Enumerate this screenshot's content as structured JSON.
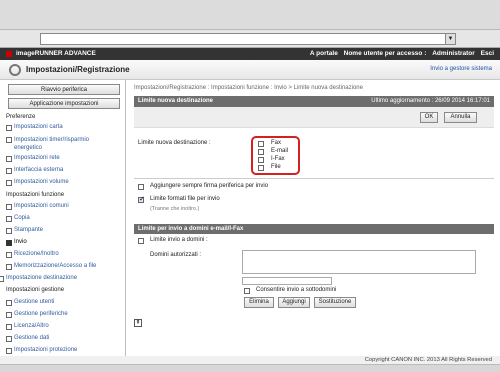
{
  "header": {
    "app_name": "imageRUNNER ADVANCE",
    "portal": "A portale",
    "user_label": "Nome utente per accesso :",
    "user_name": "Administrator",
    "logout": "Esci"
  },
  "page": {
    "title": "Impostazioni/Registrazione",
    "admin_link": "Invio a gestore sistema"
  },
  "sidebar": {
    "buttons": [
      "Riavvio periferica",
      "Applicazione impostazioni"
    ],
    "sections": {
      "preferenze": "Preferenze",
      "funzione": "Impostazioni funzione",
      "destinazione": "Impostazione destinazione",
      "gestione": "Impostazioni gestione"
    },
    "preferenze_items": [
      "Impostazioni carta",
      "Impostazioni timer/risparmio energetico",
      "Impostazioni rete",
      "Interfaccia esterna",
      "Impostazioni volume"
    ],
    "funzione_items": [
      "Impostazioni comuni",
      "Copia",
      "Stampante",
      "Invio",
      "Ricezione/Inoltro",
      "Memorizzazione/Accesso a file"
    ],
    "gestione_items": [
      "Gestione utenti",
      "Gestione periferiche",
      "Licenza/Altro",
      "Gestione dati",
      "Impostazioni protezione"
    ]
  },
  "content": {
    "breadcrumb": "Impostazioni/Registrazione : Impostazioni funzione : Invio > Limite nuova destinazione",
    "panel_title": "Limite nuova destinazione",
    "updated": "Ultimo aggiornamento : 26/09 2014 16:17:01",
    "ok": "OK",
    "cancel": "Annulla",
    "limit_label": "Limite nuova destinazione :",
    "limit_options": [
      "Fax",
      "E-mail",
      "I-Fax",
      "File"
    ],
    "always_add_signature": "Aggiungere sempre firma periferica per invio",
    "limit_file_formats": "Limite formati file per invio",
    "except_forwarding": "(Tranne che inoltro.)",
    "email_section_title": "Limite per invio a domini e-mail/I-Fax",
    "limit_send_domains": "Limite invio a domini :",
    "allowed_domains": "Domini autorizzati :",
    "allow_subdomains": "Consentire invio a sottodomini",
    "delete": "Elimina",
    "add": "Aggiungi",
    "replace": "Sostituzione",
    "scroll_icon": "⇞"
  },
  "footer": {
    "copyright": "Copyright CANON INC. 2013 All Rights Reserved"
  }
}
